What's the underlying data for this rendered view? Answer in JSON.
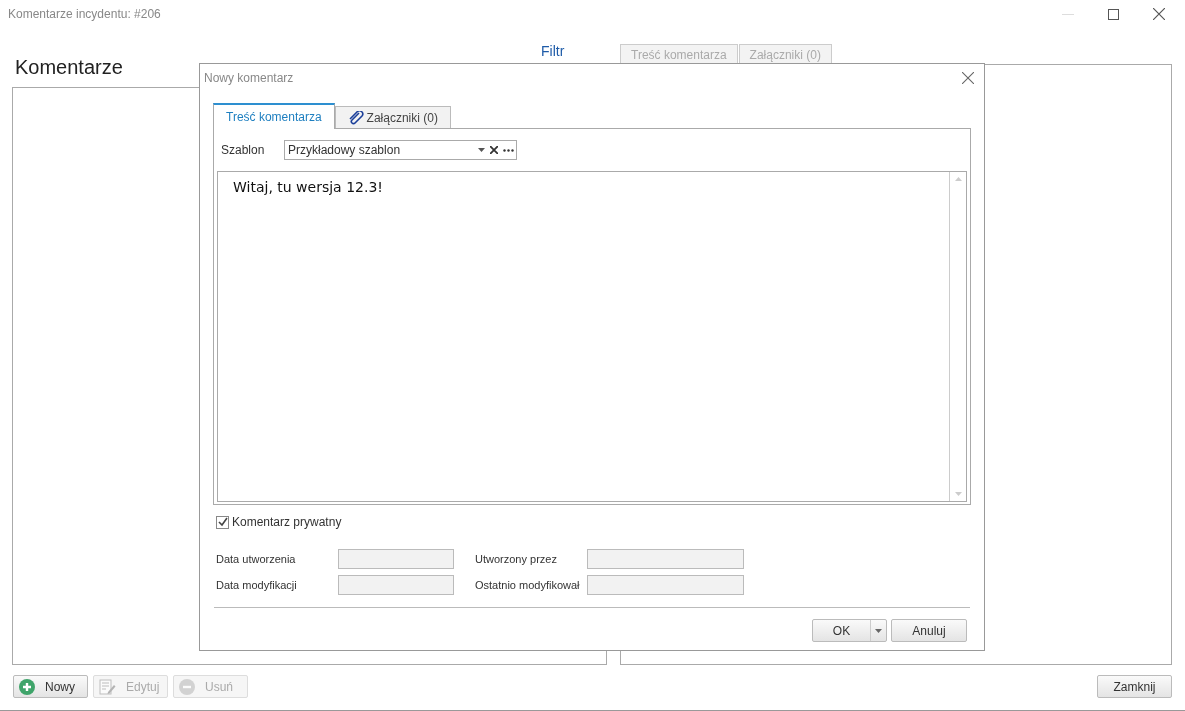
{
  "window": {
    "title": "Komentarze incydentu: #206"
  },
  "heading": "Komentarze",
  "filter_label": "Filtr",
  "background_tabs": [
    {
      "label": "Treść komentarza",
      "disabled": true
    },
    {
      "label": "Załączniki (0)",
      "disabled": true
    }
  ],
  "dialog": {
    "title": "Nowy komentarz",
    "tabs": [
      {
        "label": "Treść komentarza",
        "selected": true,
        "kind": "text"
      },
      {
        "label": "Załączniki (0)",
        "selected": false,
        "kind": "attach"
      }
    ],
    "template": {
      "label": "Szablon",
      "value": "Przykładowy szablon"
    },
    "editor_text": "Witaj, tu wersja 12.3!",
    "private": {
      "label": "Komentarz prywatny",
      "checked": true
    },
    "fields": [
      {
        "label": "Data utworzenia"
      },
      {
        "label": "Utworzony przez"
      },
      {
        "label": "Data modyfikacji"
      },
      {
        "label": "Ostatnio modyfikował"
      }
    ],
    "buttons": [
      {
        "label": "OK",
        "kind": "split"
      },
      {
        "label": "Anuluj",
        "kind": "plain"
      }
    ]
  },
  "bottom_buttons": [
    {
      "label": "Nowy",
      "kind": "add",
      "disabled": false
    },
    {
      "label": "Edytuj",
      "kind": "edit",
      "disabled": true
    },
    {
      "label": "Usuń",
      "kind": "remove",
      "disabled": true
    }
  ],
  "close_button": "Zamknij"
}
